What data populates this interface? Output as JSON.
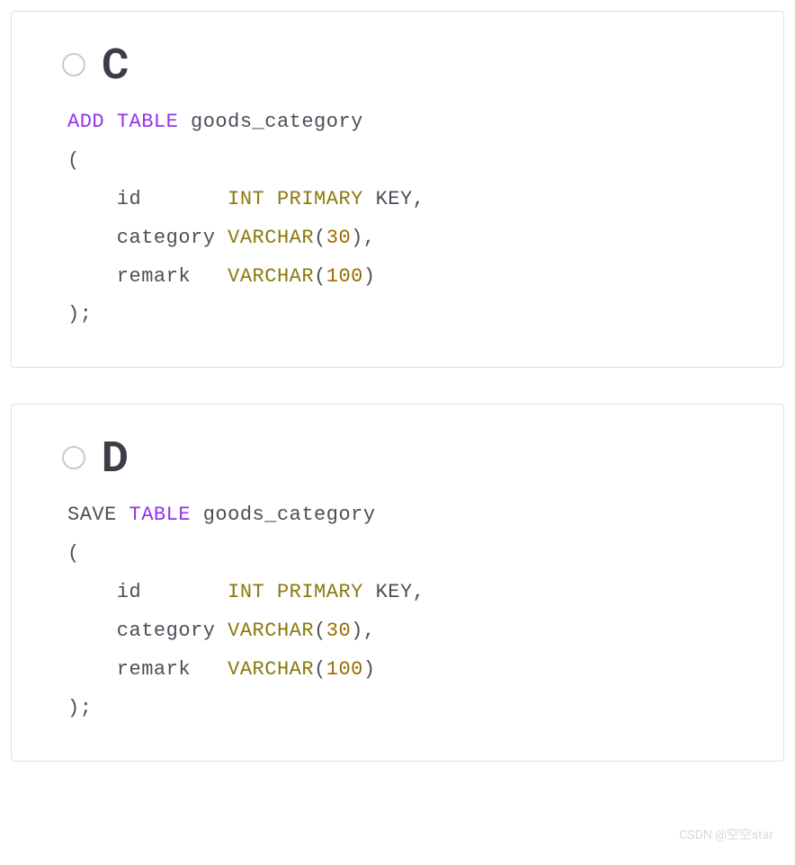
{
  "options": [
    {
      "letter": "C",
      "code": {
        "t0": "ADD",
        "t1": "TABLE",
        "t2": " goods_category",
        "t3": "(",
        "t4": "    id       ",
        "t5": "INT",
        "t6": "PRIMARY",
        "t7": " KEY",
        "t8": ",",
        "t9": "    category ",
        "t10": "VARCHAR",
        "t11": "(",
        "t12": "30",
        "t13": ")",
        "t14": ",",
        "t15": "    remark   ",
        "t16": "VARCHAR",
        "t17": "(",
        "t18": "100",
        "t19": ")",
        "t20": ");"
      }
    },
    {
      "letter": "D",
      "code": {
        "t0": "SAVE ",
        "t1": "TABLE",
        "t2": " goods_category",
        "t3": "(",
        "t4": "    id       ",
        "t5": "INT",
        "t6": "PRIMARY",
        "t7": " KEY",
        "t8": ",",
        "t9": "    category ",
        "t10": "VARCHAR",
        "t11": "(",
        "t12": "30",
        "t13": ")",
        "t14": ",",
        "t15": "    remark   ",
        "t16": "VARCHAR",
        "t17": "(",
        "t18": "100",
        "t19": ")",
        "t20": ");"
      }
    }
  ],
  "watermark": "CSDN @空空star"
}
